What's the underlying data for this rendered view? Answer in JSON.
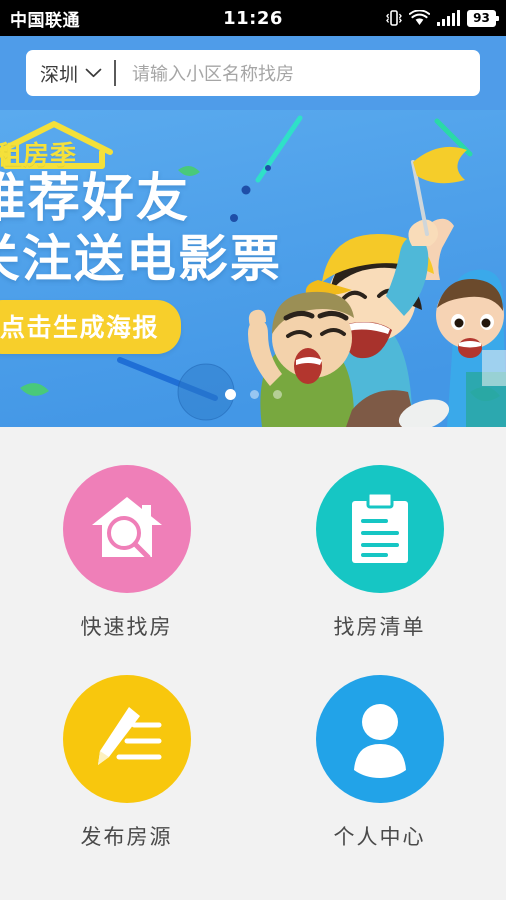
{
  "status_bar": {
    "carrier": "中国联通",
    "time": "11:26",
    "battery_level": "93",
    "icons": [
      "vibrate-icon",
      "wifi-icon",
      "signal-icon",
      "battery-icon"
    ]
  },
  "header": {
    "city": "深圳",
    "city_chevron_icon": "chevron-down-icon",
    "search_placeholder": "请输入小区名称找房",
    "search_value": "",
    "background_color": "#4f9ce9"
  },
  "banner": {
    "brand_text": "租房季",
    "brand_icon": "house-outline-icon",
    "headline_1": "推荐好友",
    "headline_2": "关注送电影票",
    "cta_label": "点击生成海报",
    "cta_color": "#f7cf2b",
    "brand_color": "#f4e03a",
    "dots_total": 3,
    "dots_active_index": 0
  },
  "menu": {
    "items": [
      {
        "label": "快速找房",
        "icon": "house-search-icon",
        "color": "#ef7fb8"
      },
      {
        "label": "找房清单",
        "icon": "clipboard-list-icon",
        "color": "#16c6c4"
      },
      {
        "label": "发布房源",
        "icon": "pencil-write-icon",
        "color": "#f8c70d"
      },
      {
        "label": "个人中心",
        "icon": "person-icon",
        "color": "#22a3e8"
      }
    ]
  },
  "page": {
    "background_color": "#f2f2f2"
  }
}
